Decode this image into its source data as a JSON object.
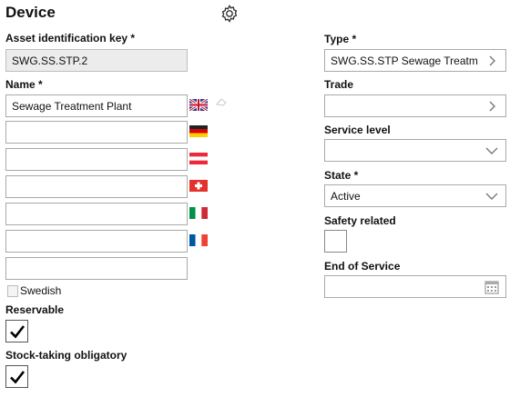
{
  "header": {
    "title": "Device",
    "settings_icon": "gear-icon"
  },
  "left": {
    "asset_key": {
      "label": "Asset identification key *",
      "value": "SWG.SS.STP.2"
    },
    "name": {
      "label": "Name *",
      "translations": [
        {
          "value": "Sewage Treatment Plant",
          "flag": "flag-uk"
        },
        {
          "value": "",
          "flag": "flag-germany"
        },
        {
          "value": "",
          "flag": "flag-austria"
        },
        {
          "value": "",
          "flag": "flag-switzerland"
        },
        {
          "value": "",
          "flag": "flag-italy"
        },
        {
          "value": "",
          "flag": "flag-france"
        },
        {
          "value": "",
          "flag": ""
        }
      ],
      "swedish_alt": "Swedish"
    },
    "reservable": {
      "label": "Reservable",
      "checked": true
    },
    "stock_taking": {
      "label": "Stock-taking obligatory",
      "checked": true
    }
  },
  "right": {
    "type": {
      "label": "Type *",
      "value": "SWG.SS.STP Sewage Treatm"
    },
    "trade": {
      "label": "Trade",
      "value": ""
    },
    "service_level": {
      "label": "Service level",
      "value": ""
    },
    "state": {
      "label": "State *",
      "value": "Active"
    },
    "safety_related": {
      "label": "Safety related",
      "checked": false
    },
    "end_of_service": {
      "label": "End of Service",
      "value": ""
    }
  },
  "colors": {
    "readonly_bg": "#ececec",
    "border": "#a9a9a9"
  }
}
